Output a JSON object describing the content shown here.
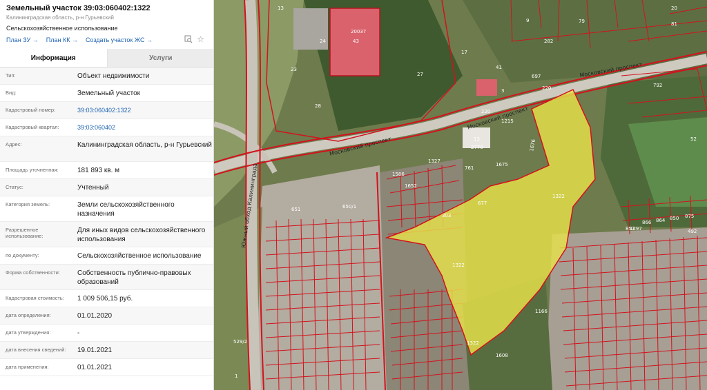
{
  "header": {
    "title": "Земельный участок 39:03:060402:1322",
    "address_short": "Калининградская область, р-н Гурьевский",
    "purpose": "Сельскохозяйственное использование",
    "links": [
      "План ЗУ →",
      "План КК →",
      "Создать участок ЖС →"
    ]
  },
  "tabs": [
    "Информация",
    "Услуги"
  ],
  "rows": [
    {
      "label": "Тип:",
      "value": "Объект недвижимости"
    },
    {
      "label": "Вид:",
      "value": "Земельный участок"
    },
    {
      "label": "Кадастровый номер:",
      "value": "39:03:060402:1322"
    },
    {
      "label": "Кадастровый квартал:",
      "value": "39:03:060402"
    },
    {
      "label": "Адрес:",
      "value": "Калининградская область, р-н Гурьевский"
    },
    {
      "label": "Площадь уточненная:",
      "value": "181 893 кв. м"
    },
    {
      "label": "Статус:",
      "value": "Учтенный"
    },
    {
      "label": "Категория земель:",
      "value": "Земли сельскохозяйственного назначения"
    },
    {
      "label": "Разрешенное использование:",
      "value": "Для иных видов сельскохозяйственного использования"
    },
    {
      "label": "по документу:",
      "value": "Сельскохозяйственное использование"
    },
    {
      "label": "Форма собственности:",
      "value": "Собственность публично-правовых образований"
    },
    {
      "label": "Кадастровая стоимость:",
      "value": "1 009 506,15 руб."
    },
    {
      "label": "дата определения:",
      "value": "01.01.2020"
    },
    {
      "label": "дата утверждения:",
      "value": "-"
    },
    {
      "label": "дата внесения сведений:",
      "value": "19.01.2021"
    },
    {
      "label": "дата применения:",
      "value": "01.01.2021"
    }
  ],
  "map": {
    "road_labels": [
      "Московский проспект",
      "Московский проспект",
      "Московский проспект",
      "Южный обход Калининграда"
    ],
    "parcel_numbers": [
      "20037",
      "43",
      "24",
      "23",
      "27",
      "17",
      "41",
      "28",
      "13",
      "9",
      "282",
      "79",
      "81",
      "20",
      "697",
      "220",
      "3",
      "792",
      "52",
      "220",
      "1215",
      "1676",
      "13",
      "2770",
      "1675",
      "761",
      "1327",
      "1586",
      "1652",
      "677",
      "303",
      "651",
      "650/1",
      "1322",
      "1322",
      "857",
      "1297",
      "866",
      "864",
      "850",
      "875",
      "492",
      "1166",
      "1608",
      "1322",
      "529/2",
      "1"
    ]
  },
  "colors": {
    "link": "#1f63b3",
    "highlight": "#e6e24a",
    "boundary": "#d3121d"
  }
}
